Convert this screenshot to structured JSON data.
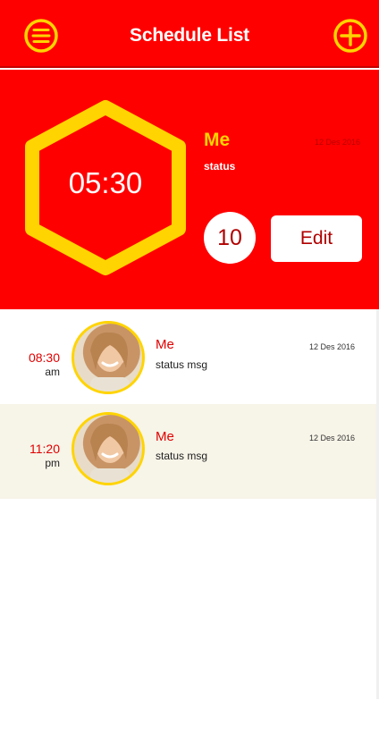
{
  "header": {
    "title": "Schedule List",
    "menu_icon": "menu-icon",
    "add_icon": "add-icon",
    "accent_color": "#ff0000",
    "highlight_color": "#ffd400"
  },
  "hero": {
    "time": "05:30",
    "name": "Me",
    "date": "12 Des 2016",
    "status": "status",
    "count": "10",
    "edit_label": "Edit"
  },
  "schedule": {
    "items": [
      {
        "time": "08:30",
        "ampm": "am",
        "name": "Me",
        "date": "12 Des 2016",
        "status": "status msg"
      },
      {
        "time": "11:20",
        "ampm": "pm",
        "name": "Me",
        "date": "12 Des 2016",
        "status": "status msg"
      }
    ]
  }
}
